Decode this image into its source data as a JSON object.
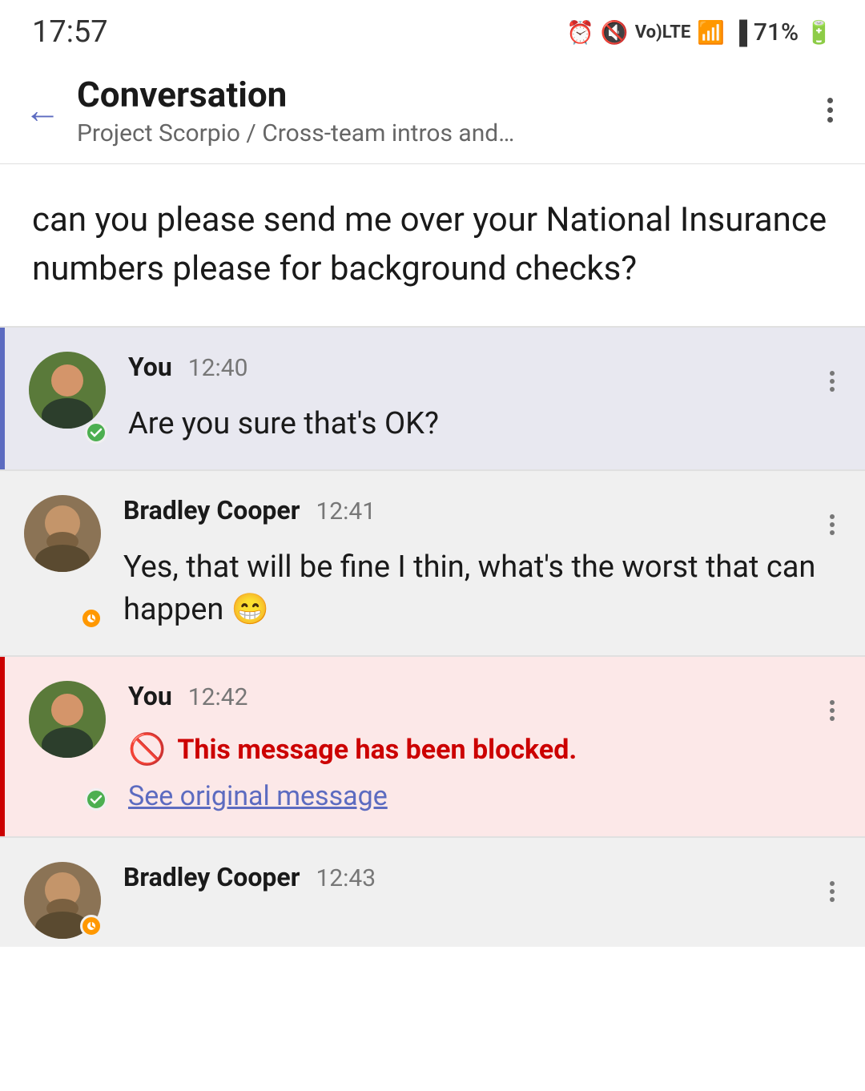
{
  "statusBar": {
    "time": "17:57",
    "battery": "71%"
  },
  "header": {
    "title": "Conversation",
    "subtitle": "Project Scorpio / Cross-team intros and…",
    "backLabel": "←",
    "moreLabel": "⋮"
  },
  "quotedMessage": {
    "text": "can you please send me over your National Insurance numbers please for background checks?"
  },
  "messages": [
    {
      "id": "msg1",
      "author": "You",
      "time": "12:40",
      "text": "Are you sure that's OK?",
      "status": "online",
      "blocked": false,
      "highlighted": true
    },
    {
      "id": "msg2",
      "author": "Bradley Cooper",
      "time": "12:41",
      "text": "Yes, that will be fine I thin, what's the worst that can happen 😁",
      "status": "away",
      "blocked": false,
      "highlighted": false
    },
    {
      "id": "msg3",
      "author": "You",
      "time": "12:42",
      "blockedLabel": "This message has been blocked.",
      "seeOriginal": "See original message",
      "status": "online",
      "blocked": true,
      "highlighted": false
    },
    {
      "id": "msg4",
      "author": "Bradley Cooper",
      "time": "12:43",
      "text": "",
      "status": "away",
      "blocked": false,
      "highlighted": false,
      "partial": true
    }
  ]
}
